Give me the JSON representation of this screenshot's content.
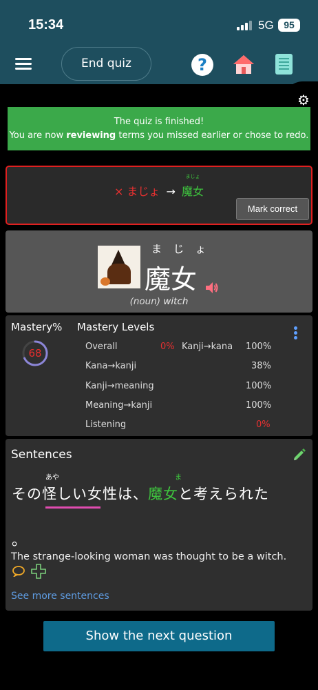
{
  "status": {
    "time": "15:34",
    "network": "5G",
    "battery": "95"
  },
  "header": {
    "end_quiz_label": "End quiz",
    "help_glyph": "?"
  },
  "banner": {
    "line1": "The quiz is finished!",
    "line2_pre": "You are now ",
    "line2_bold": "reviewing",
    "line2_post": " terms you missed earlier or chose to redo."
  },
  "answer": {
    "wrong": "× まじょ",
    "arrow": "→",
    "correct": "魔女",
    "correct_furigana": "まじょ",
    "mark_correct_label": "Mark correct"
  },
  "word": {
    "reading": "まじょ",
    "kanji": "魔女",
    "pos": "(noun)",
    "meaning": "witch"
  },
  "mastery": {
    "title": "Mastery%",
    "value": "68",
    "percent": 68,
    "levels_title": "Mastery Levels",
    "levels": [
      {
        "label": "Overall",
        "value": "0%"
      },
      {
        "label": "Kanji→kana",
        "value": "100%"
      },
      {
        "label": "Kana→kanji",
        "value": "38%"
      },
      {
        "label": "Kanji→meaning",
        "value": "100%"
      },
      {
        "label": "Meaning→kanji",
        "value": "100%"
      },
      {
        "label": "Listening",
        "value": "0%"
      }
    ]
  },
  "sentences": {
    "title": "Sentences",
    "jp_part1": "その",
    "jp_part2": "怪しい",
    "jp_part3": "女性は、",
    "jp_part4": "魔女",
    "jp_part5": "と考えられた",
    "jp_end": "。",
    "furigana_aya": "あや",
    "furigana_ma": "ま",
    "english": "The strange-looking woman was thought to be a witch.",
    "see_more": "See more sentences"
  },
  "footer": {
    "next_label": "Show the next question"
  },
  "colors": {
    "header": "#1e4e5e",
    "banner": "#3ba94a",
    "error": "#e02020",
    "accent_green": "#3ec43e",
    "link": "#5e9be0",
    "primary_button": "#0e6a8a"
  }
}
